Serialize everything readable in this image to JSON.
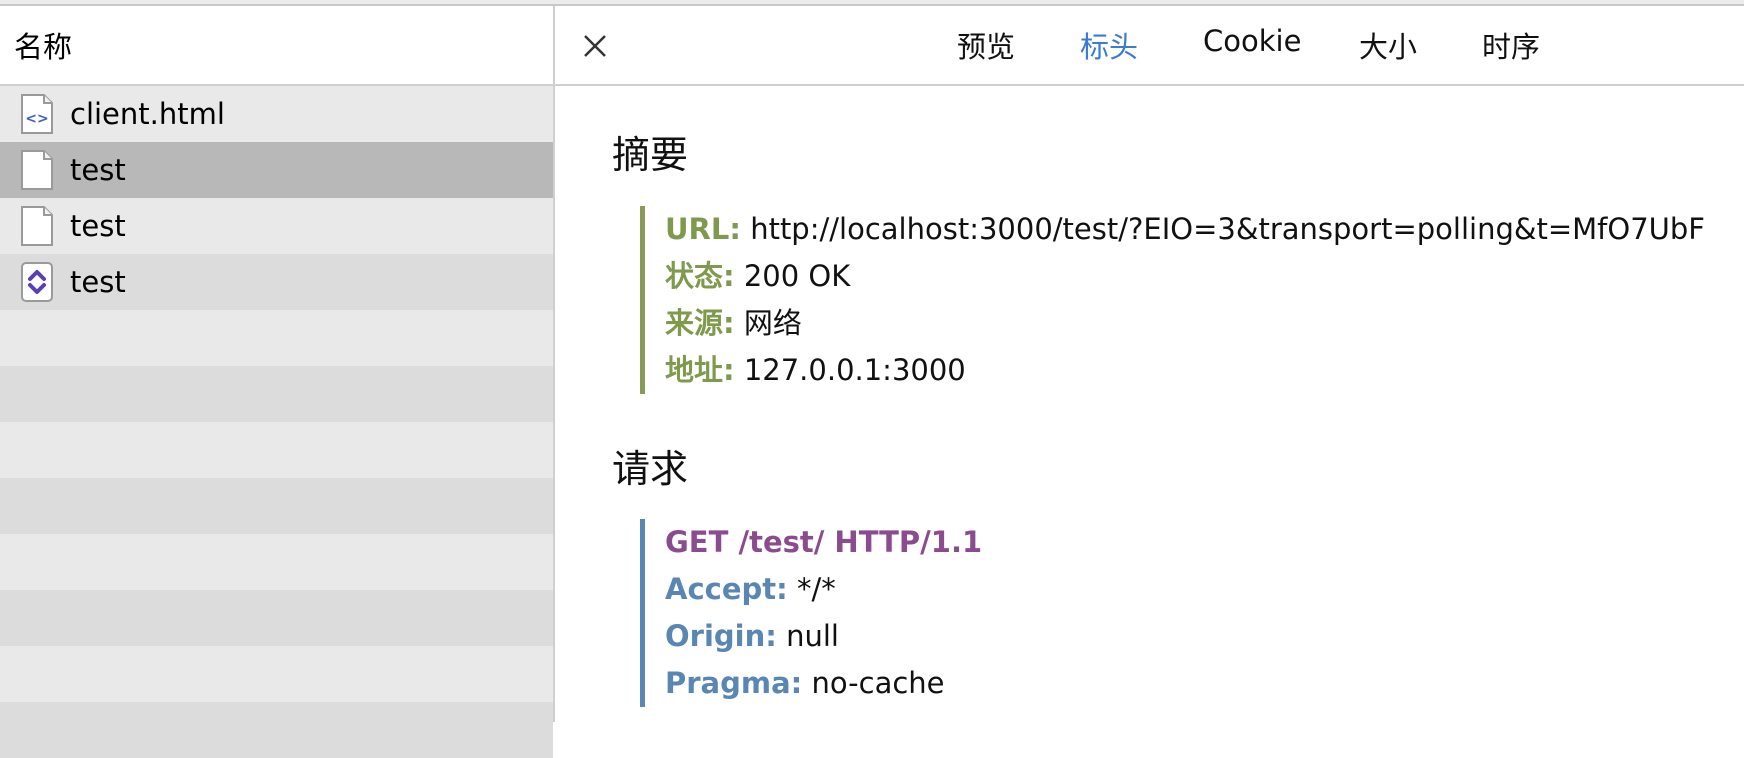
{
  "left_panel": {
    "header": "名称",
    "files": [
      {
        "name": "client.html",
        "icon": "html-file-icon",
        "selected": false
      },
      {
        "name": "test",
        "icon": "blank-file-icon",
        "selected": true
      },
      {
        "name": "test",
        "icon": "blank-file-icon",
        "selected": false
      },
      {
        "name": "test",
        "icon": "websocket-file-icon",
        "selected": false
      }
    ]
  },
  "tabs": {
    "preview": "预览",
    "headers": "标头",
    "cookie": "Cookie",
    "size": "大小",
    "timing": "时序",
    "active": "标头",
    "active_color": "#3a7bd5"
  },
  "summary": {
    "title": "摘要",
    "url_key": "URL:",
    "url_val": "http://localhost:3000/test/?EIO=3&transport=polling&t=MfO7UbF",
    "status_key": "状态:",
    "status_val": "200 OK",
    "source_key": "来源:",
    "source_val": "网络",
    "address_key": "地址:",
    "address_val": "127.0.0.1:3000",
    "accent_color": "#7f9a4c"
  },
  "request": {
    "title": "请求",
    "request_line": "GET /test/ HTTP/1.1",
    "accept_key": "Accept:",
    "accept_val": "*/*",
    "origin_key": "Origin:",
    "origin_val": "null",
    "pragma_key": "Pragma:",
    "pragma_val": "no-cache",
    "accent_color": "#5a86b3"
  }
}
